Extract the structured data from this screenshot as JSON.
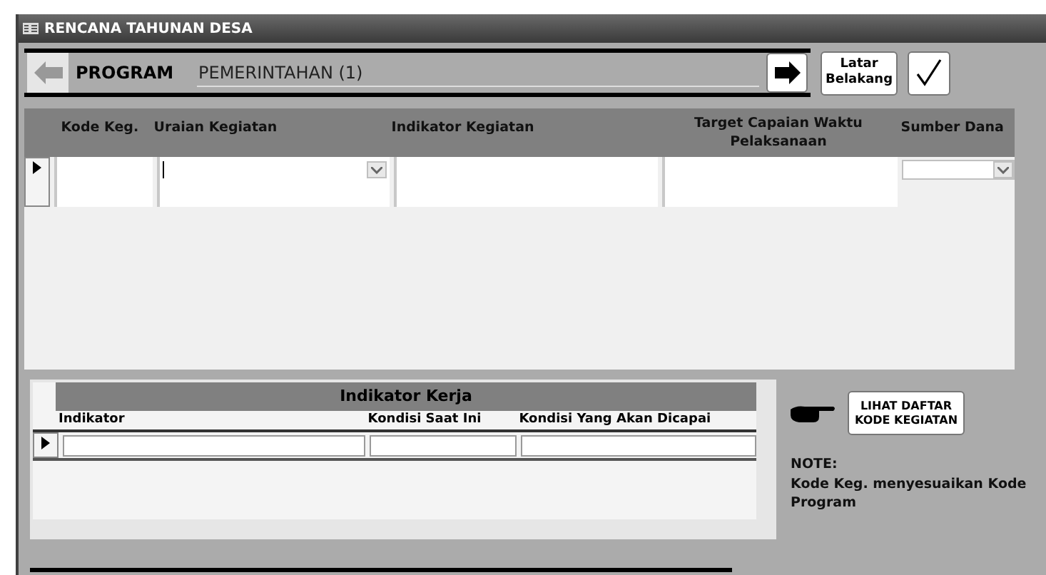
{
  "window": {
    "title": "RENCANA TAHUNAN DESA"
  },
  "toolbar": {
    "label": "PROGRAM",
    "value": "PEMERINTAHAN (1)",
    "background_button": "Latar Belakang"
  },
  "activity_grid": {
    "columns": [
      {
        "label": "Kode Keg.",
        "kind": "text"
      },
      {
        "label": "Uraian Kegiatan",
        "kind": "combo"
      },
      {
        "label": "Indikator Kegiatan",
        "kind": "text"
      },
      {
        "label": "Target Capaian Waktu Pelaksanaan",
        "kind": "text"
      },
      {
        "label": "Sumber Dana",
        "kind": "dropdown"
      }
    ],
    "rows": [
      {
        "selected": true
      }
    ]
  },
  "indicator_grid": {
    "title": "Indikator Kerja",
    "columns": [
      "Indikator",
      "Kondisi Saat Ini",
      "Kondisi Yang Akan Dicapai"
    ],
    "rows": [
      {
        "selected": true
      }
    ]
  },
  "side": {
    "link_button": "LIHAT DAFTAR KODE KEGIATAN",
    "note_title": "NOTE:",
    "note": "Kode Keg. menyesuaikan Kode Program"
  }
}
